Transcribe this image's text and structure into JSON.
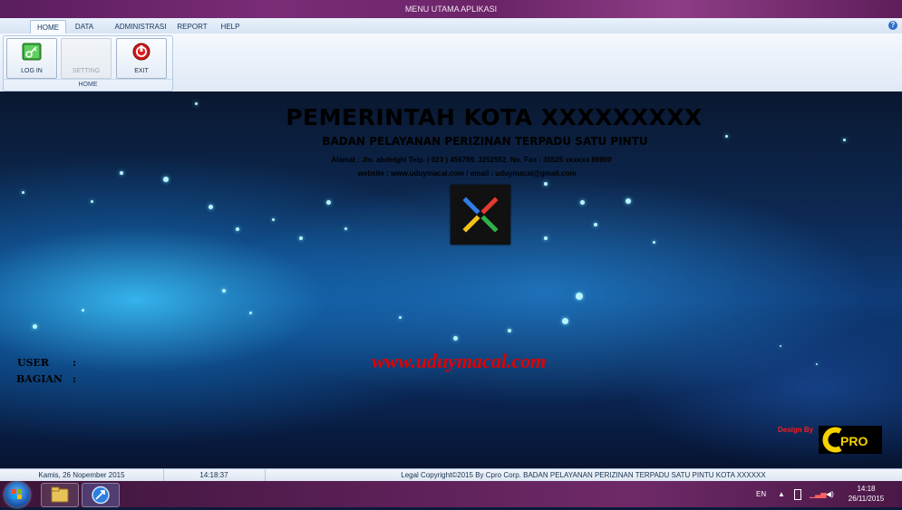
{
  "window": {
    "title": "MENU UTAMA APLIKASI"
  },
  "ribbon": {
    "tabs": [
      {
        "label": "HOME",
        "active": true
      },
      {
        "label": "DATA"
      },
      {
        "label": "ADMINISTRASI"
      },
      {
        "label": "REPORT"
      },
      {
        "label": "HELP"
      }
    ],
    "group_label": "HOME",
    "buttons": [
      {
        "label": "LOG IN",
        "icon": "login-icon",
        "enabled": true
      },
      {
        "label": "SETTING",
        "icon": "settings-icon",
        "enabled": false
      },
      {
        "label": "EXIT",
        "icon": "exit-icon",
        "enabled": true
      }
    ],
    "help_icon": "?"
  },
  "header": {
    "title": "PEMERINTAH KOTA XXXXXXXXX",
    "subtitle": "BADAN PELAYANAN PERIZINAN TERPADU SATU PINTU",
    "address": "Alamat : Jln. abdefghi Telp. ( 023 ) 456789. 3252552. No. Fax : 35525 xxxxxx 89800",
    "website_line": "website : www.uduymacal.com / email : uduymacal@gmail.com"
  },
  "user_panel": {
    "user_label": "USER",
    "bagian_label": "BAGIAN",
    "separator": ":"
  },
  "watermark_url": "www.uduymacal.com",
  "credit": {
    "design_by": "Design By",
    "logo_text": "CPRO"
  },
  "status": {
    "date": "Kamis, 26 Nopember 2015",
    "time": "14:18:37",
    "copyright": "Legal Copyright©2015 By Cpro Corp. BADAN PELAYANAN PERIZINAN TERPADU SATU PINTU KOTA XXXXXX"
  },
  "taskbar": {
    "language": "EN",
    "clock_time": "14:18",
    "clock_date": "26/11/2015"
  },
  "colors": {
    "title_text": "#000000",
    "watermark": "#e00000",
    "design_by": "#ff1a1a",
    "cpro_yellow": "#f5d200"
  }
}
